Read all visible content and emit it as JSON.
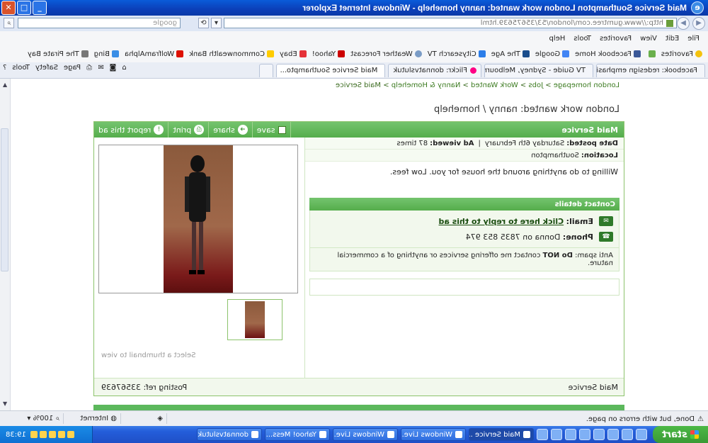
{
  "window": {
    "title": "Maid Service Southampton London work wanted: nanny homehelp - Windows Internet Explorer",
    "icon": "ie-icon"
  },
  "address": {
    "url": "http://www.gumtree.com/london/53/35675639.html",
    "search_placeholder": "google"
  },
  "menu": [
    "File",
    "Edit",
    "View",
    "Favorites",
    "Tools",
    "Help"
  ],
  "favorites": {
    "label": "Favorites",
    "items": [
      {
        "label": "Facebook Home",
        "color": "#3b5998"
      },
      {
        "label": "Google",
        "color": "#4285f4"
      },
      {
        "label": "The Age",
        "color": "#1a4d8c"
      },
      {
        "label": "Citysearch TV",
        "color": "#2b7de9"
      },
      {
        "label": "Weather Forecast",
        "color": "#7a9cc6"
      },
      {
        "label": "Yahoo!",
        "color": "#c00"
      },
      {
        "label": "Ebay",
        "color": "#e53238"
      },
      {
        "label": "Commonwealth Bank",
        "color": "#ffcc00"
      },
      {
        "label": "WolframAlpha",
        "color": "#dd1100"
      },
      {
        "label": "Bing",
        "color": "#3a8ee6"
      },
      {
        "label": "The Pirate Bay",
        "color": "#777"
      }
    ]
  },
  "tabs": [
    {
      "label": "Facebook: redesign emphasis...",
      "active": false,
      "color": "#3b5998"
    },
    {
      "label": "TV Guide - Sydney, Melbourn...",
      "active": false,
      "color": "#2b7de9"
    },
    {
      "label": "Flickr: donnatvslutuk",
      "active": false,
      "color": "#ff0084"
    },
    {
      "label": "Maid Service Southampto...",
      "active": true,
      "color": "#6a9e3b"
    }
  ],
  "commands": [
    "Page",
    "Safety",
    "Tools"
  ],
  "page": {
    "breadcrumb": [
      "London homepage",
      "Jobs",
      "Work Wanted",
      "Nanny & Homehelp",
      "Maid Service"
    ],
    "heading": "London work wanted: nanny / homehelp",
    "ad": {
      "category": "Maid Service",
      "tools": [
        {
          "label": "save",
          "type": "checkbox"
        },
        {
          "label": "share",
          "icon": "share-icon"
        },
        {
          "label": "print",
          "icon": "printer-icon"
        },
        {
          "label": "report this ad",
          "icon": "report-icon"
        }
      ],
      "date_label": "Date posted:",
      "date_value": "Saturday 6th February",
      "views_label": "Ad viewed:",
      "views_value": "87 times",
      "location_label": "Location:",
      "location_value": "Southampton",
      "description": "Willing to do anything around the house for you. Low fees.",
      "contact_header": "Contact details",
      "email_label": "Email:",
      "email_link": "Click here to reply to this ad",
      "phone_label": "Phone:",
      "phone_value": "Donna on 7835 853 974",
      "antispam_label": "Anti spam:",
      "antispam_strong": "Do NOT",
      "antispam_text": "contact me offering services or anything of a commercial nature.",
      "thumb_hint": "Select a thumbnail to view",
      "footer_left": "Maid Service",
      "footer_right_label": "Posting ref:",
      "footer_right_value": "33567639"
    }
  },
  "status": {
    "text": "Done, but with errors on page.",
    "zone": "Internet",
    "zoom": "100%"
  },
  "taskbar": {
    "start": "start",
    "tasks": [
      {
        "label": "Maid Service ...",
        "active": true
      },
      {
        "label": "Windows Live...",
        "active": false
      },
      {
        "label": "Windows Live...",
        "active": false
      },
      {
        "label": "Yahoo! Mess...",
        "active": false
      },
      {
        "label": "donnatvslutuk",
        "active": false
      }
    ],
    "clock": "19:38"
  }
}
